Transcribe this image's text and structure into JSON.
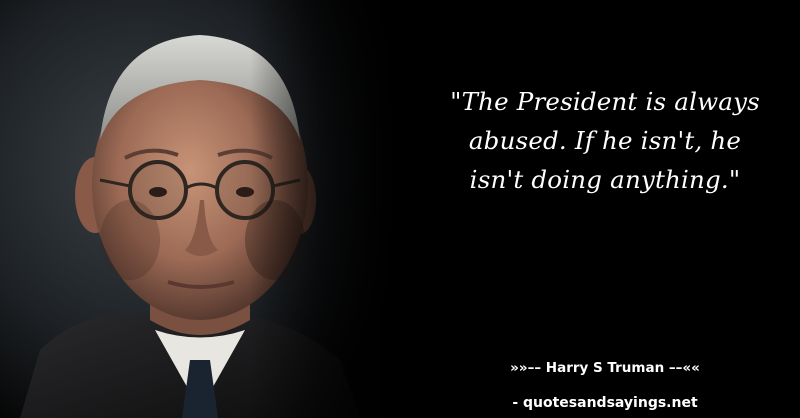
{
  "quote": {
    "text": "\"The President is always abused. If he isn't, he isn't doing anything.\""
  },
  "attribution": {
    "author_line": "»»–– Harry S Truman ––««"
  },
  "footer": {
    "site": "- quotesandsayings.net"
  },
  "colors": {
    "background": "#000000",
    "text": "#ffffff"
  }
}
